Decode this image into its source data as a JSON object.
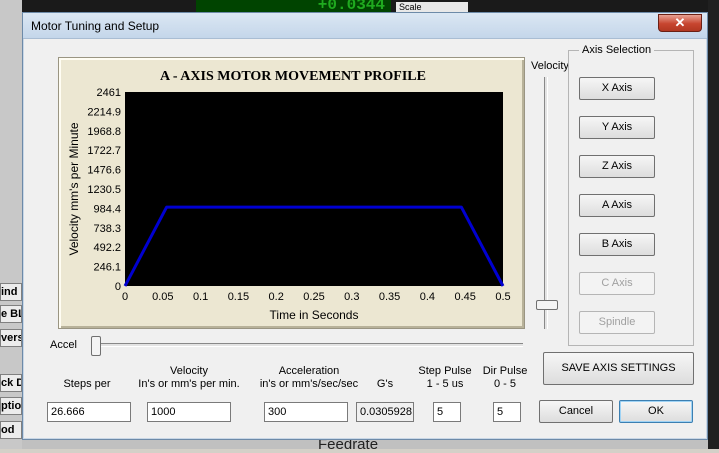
{
  "background": {
    "dro_value": "+0.0344",
    "scale_label": "Scale",
    "left_fragments": [
      "ind",
      "e BL",
      "vers",
      "ck D",
      "ptio",
      "od"
    ],
    "bottom_fragment": "Feedrate"
  },
  "dialog": {
    "title": "Motor Tuning and Setup",
    "close_label": "✕"
  },
  "colors": {
    "plot_bg": "#000000",
    "profile_line": "#0000d0",
    "panel_bg": "#ece7d2"
  },
  "chart_data": {
    "type": "line",
    "title": "A - AXIS MOTOR MOVEMENT PROFILE",
    "xlabel": "Time in Seconds",
    "ylabel": "Velocity mm's per Minute",
    "x_ticks": [
      "0",
      "0.05",
      "0.1",
      "0.15",
      "0.2",
      "0.25",
      "0.3",
      "0.35",
      "0.4",
      "0.45",
      "0.5"
    ],
    "y_ticks": [
      "0",
      "246.1",
      "492.2",
      "738.3",
      "984.4",
      "1230.5",
      "1476.6",
      "1722.7",
      "1968.8",
      "2214.9",
      "2461"
    ],
    "xlim": [
      0,
      0.5
    ],
    "ylim": [
      0,
      2461
    ],
    "grid": false,
    "series": [
      {
        "x": [
          0,
          0.055,
          0.445,
          0.5
        ],
        "y": [
          0,
          1000,
          1000,
          0
        ]
      }
    ]
  },
  "velocity_slider": {
    "label": "Velocity",
    "level": 0.05
  },
  "accel_slider": {
    "label": "Accel",
    "level": 0.0
  },
  "axis_selection": {
    "label": "Axis Selection",
    "buttons": [
      "X Axis",
      "Y Axis",
      "Z Axis",
      "A Axis",
      "B Axis",
      "C Axis",
      "Spindle"
    ]
  },
  "fields": {
    "steps_per": {
      "label": "Steps per",
      "value": "26.666"
    },
    "velocity": {
      "label1": "Velocity",
      "label2": "In's or mm's per min.",
      "value": "1000"
    },
    "acceleration": {
      "label1": "Acceleration",
      "label2": "in's or mm's/sec/sec",
      "value": "300"
    },
    "gs": {
      "label": "G's",
      "value": "0.0305928"
    },
    "step_pulse": {
      "label1": "Step Pulse",
      "label2": "1 - 5 us",
      "value": "5"
    },
    "dir_pulse": {
      "label1": "Dir Pulse",
      "label2": "0 - 5",
      "value": "5"
    }
  },
  "buttons": {
    "save": "SAVE AXIS SETTINGS",
    "cancel": "Cancel",
    "ok": "OK"
  }
}
